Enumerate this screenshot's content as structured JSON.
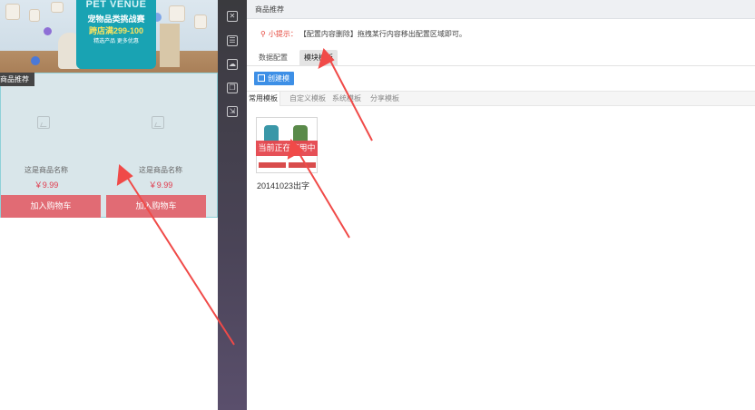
{
  "preview": {
    "banner": {
      "brand": "PET VENUE",
      "line1": "宠物品类挑战赛",
      "line2": "跨店满299-100",
      "line3": "精选产品 更多优惠"
    },
    "section_tag": "商品推荐",
    "products": [
      {
        "name": "这是商品名称",
        "price": "￥9.99",
        "cart_label": "加入购物车"
      },
      {
        "name": "这是商品名称",
        "price": "￥9.99",
        "cart_label": "加入购物车"
      }
    ]
  },
  "toolbar": {
    "tools": [
      "delete-icon",
      "module-icon",
      "cloud-icon",
      "copy-icon",
      "export-icon"
    ]
  },
  "panel": {
    "title": "商品推荐",
    "tip_label": "小提示：",
    "tip_text": "【配置内容删除】拖拽某行内容移出配置区域即可。",
    "tabs": [
      {
        "label": "数据配置",
        "active": false
      },
      {
        "label": "模块模板",
        "active": true
      }
    ],
    "create_button": "创建模",
    "sub_tabs": [
      {
        "label": "常用模板",
        "active": true
      },
      {
        "label": "自定义模板",
        "active": false
      },
      {
        "label": "系统模板",
        "active": false
      },
      {
        "label": "分享模板",
        "active": false
      }
    ],
    "template": {
      "status": "当前正在使用中",
      "name": "20141023出字"
    }
  },
  "colors": {
    "accent": "#3d8fe6",
    "danger": "#e5474f",
    "price": "#e0374a",
    "cart": "#e16b74",
    "toolbar": "#3a3a3e",
    "arrow": "#f04a48"
  }
}
